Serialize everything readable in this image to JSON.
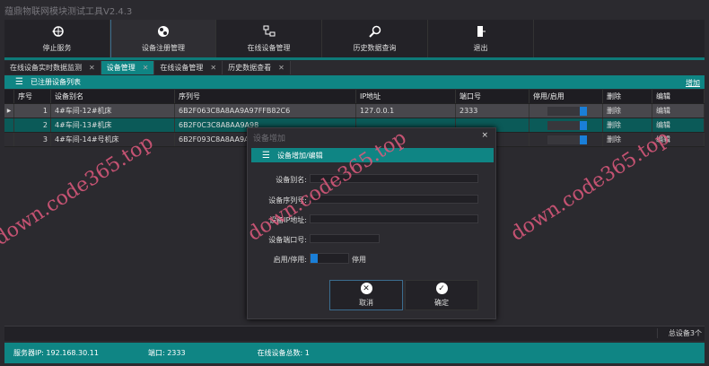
{
  "title": "蕴鼎物联网模块测试工具V2.4.3",
  "toolbar": [
    {
      "label": "停止服务",
      "icon": "globe-icon"
    },
    {
      "label": "设备注册管理",
      "icon": "devices-icon"
    },
    {
      "label": "在线设备管理",
      "icon": "network-icon"
    },
    {
      "label": "历史数据查询",
      "icon": "search-icon"
    },
    {
      "label": "退出",
      "icon": "exit-icon"
    }
  ],
  "tabs": [
    {
      "label": "在线设备实时数据监测"
    },
    {
      "label": "设备管理"
    },
    {
      "label": "在线设备管理"
    },
    {
      "label": "历史数据查看"
    }
  ],
  "list": {
    "title": "已注册设备列表",
    "add_label": "增加",
    "columns": [
      "序号",
      "设备别名",
      "序列号",
      "IP地址",
      "端口号",
      "停用/启用",
      "删除",
      "编辑"
    ],
    "rows": [
      {
        "no": "1",
        "name": "4#车间-12#机床",
        "serial": "6B2F063C8A8AA9A97FFB82C6",
        "ip": "127.0.0.1",
        "port": "2333",
        "enabled": true,
        "del": "删除",
        "edit": "编辑"
      },
      {
        "no": "2",
        "name": "4#车间-13#机床",
        "serial": "6B2F0C3C8A8AA9A98",
        "ip": "",
        "port": "",
        "enabled": true,
        "del": "删除",
        "edit": "编辑"
      },
      {
        "no": "3",
        "name": "4#车间-14#号机床",
        "serial": "6B2F093C8A8AA9A97",
        "ip": "",
        "port": "",
        "enabled": true,
        "del": "删除",
        "edit": "编辑"
      }
    ],
    "total": "总设备3个"
  },
  "status": {
    "server_ip": "服务器IP:  192.168.30.11",
    "port": "端口:  2333",
    "online": "在线设备总数:  1"
  },
  "dialog": {
    "title": "设备增加",
    "close": "×",
    "header": "设备增加/编辑",
    "fields": [
      {
        "label": "设备别名:",
        "value": ""
      },
      {
        "label": "设备序列号:",
        "value": ""
      },
      {
        "label": "设备IP地址:",
        "value": ""
      },
      {
        "label": "设备端口号:",
        "value": ""
      }
    ],
    "toggle_label": "启用/停用:",
    "toggle_state": "停用",
    "cancel": "取消",
    "ok": "确定"
  },
  "watermark": "down.code365.top",
  "colors": {
    "accent": "#0f8584",
    "toggle": "#1a7fd8"
  }
}
